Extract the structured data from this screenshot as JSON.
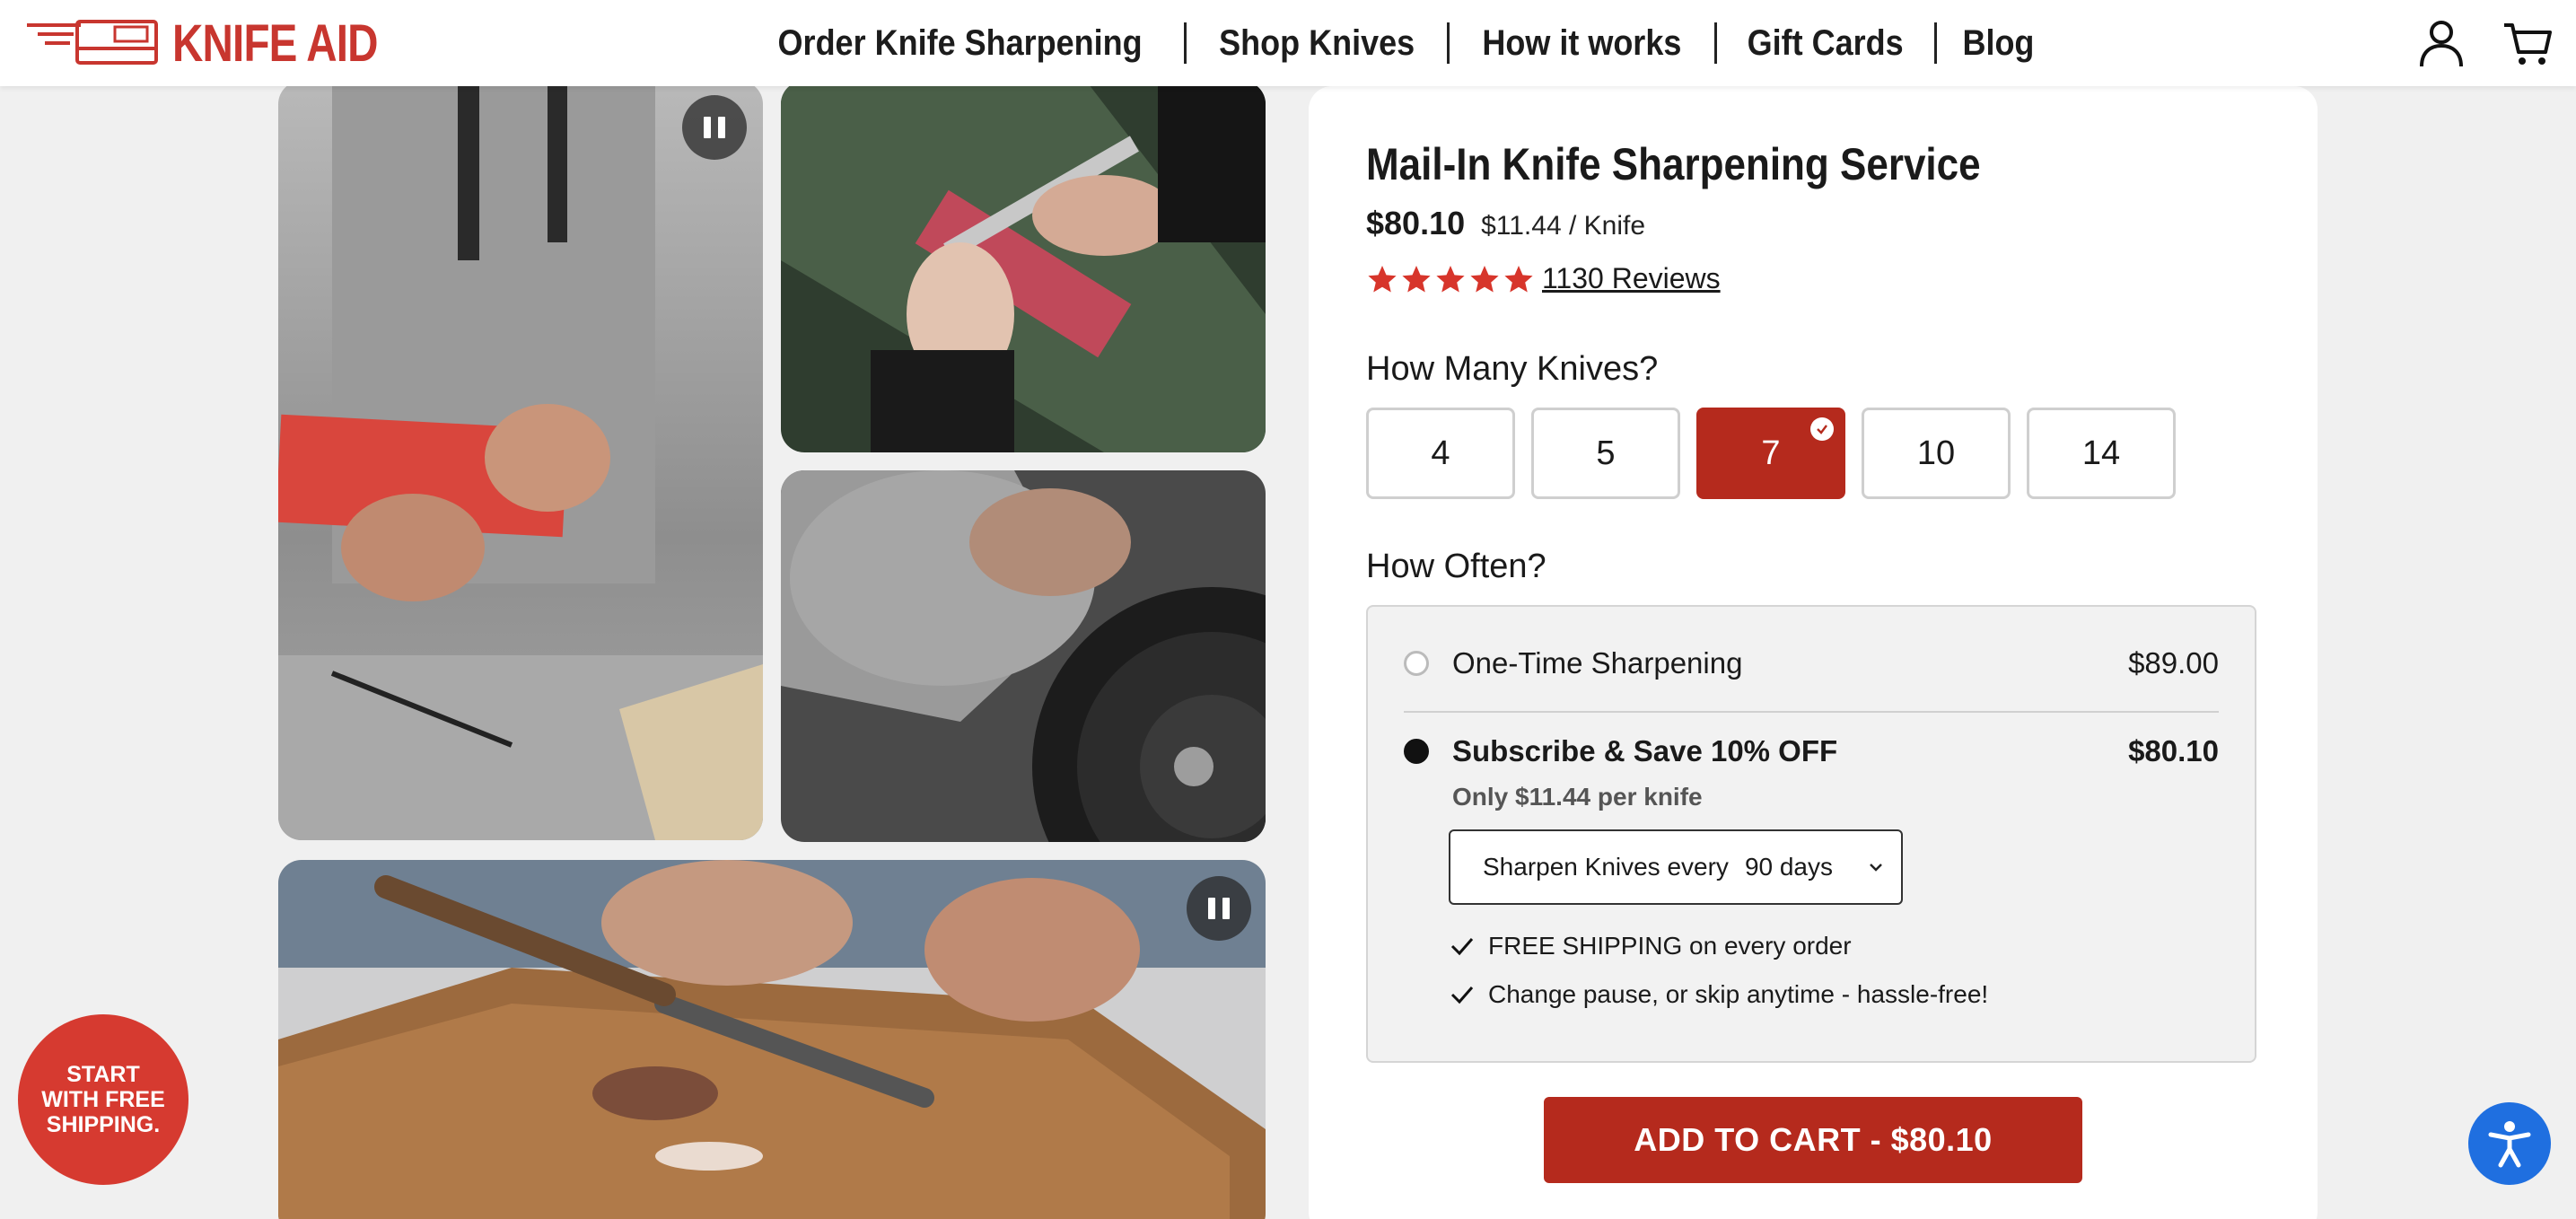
{
  "header": {
    "brand": "KNIFE AID",
    "nav": [
      "Order Knife Sharpening",
      "Shop Knives",
      "How it works",
      "Gift Cards",
      "Blog"
    ],
    "icons": [
      "account-icon",
      "cart-icon"
    ]
  },
  "product": {
    "title": "Mail-In Knife Sharpening Service",
    "price": "$80.10",
    "per_knife": "$11.44 / Knife",
    "rating": 5,
    "reviews": "1130 Reviews",
    "qty_label": "How Many Knives?",
    "quantities": [
      "4",
      "5",
      "7",
      "10",
      "14"
    ],
    "selected_quantity": "7",
    "freq_label": "How Often?",
    "options": {
      "one_time": {
        "label": "One-Time Sharpening",
        "price": "$89.00"
      },
      "subscribe": {
        "label": "Subscribe & Save 10% OFF",
        "price": "$80.10",
        "note": "Only $11.44 per knife"
      }
    },
    "frequency_select": {
      "prefix": "Sharpen Knives every",
      "value": "90 days"
    },
    "perks": [
      "FREE SHIPPING on every order",
      "Change pause, or skip anytime - hassle-free!"
    ],
    "cta": "ADD TO CART - $80.10"
  },
  "promo_badge": "START WITH FREE SHIPPING.",
  "colors": {
    "brand_red": "#b52a1d",
    "logo_red": "#c8362f",
    "accessibility_blue": "#1f6fe0"
  }
}
